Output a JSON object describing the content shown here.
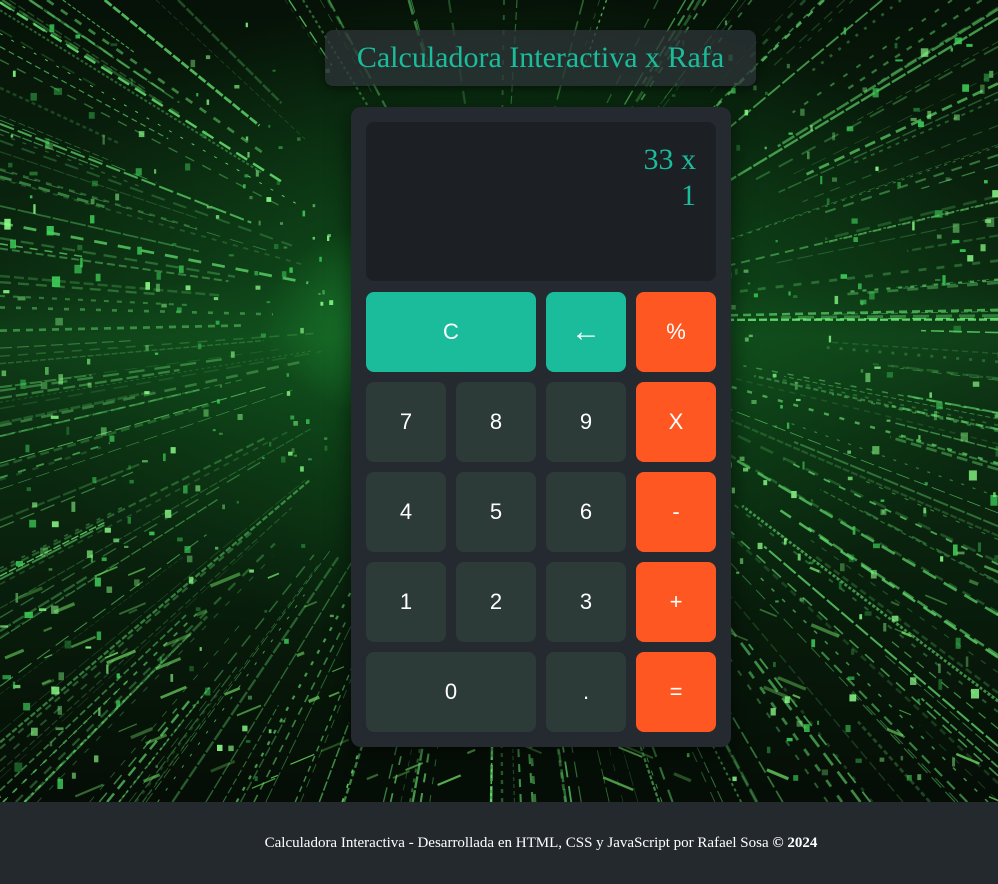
{
  "header": {
    "title": "Calculadora Interactiva x Rafa"
  },
  "display": {
    "line1": "33 x",
    "line2": "1"
  },
  "buttons": {
    "clear": "C",
    "backspace": "←",
    "percent": "%",
    "seven": "7",
    "eight": "8",
    "nine": "9",
    "multiply": "X",
    "four": "4",
    "five": "5",
    "six": "6",
    "minus": "-",
    "one": "1",
    "two": "2",
    "three": "3",
    "plus": "+",
    "zero": "0",
    "decimal": ".",
    "equals": "="
  },
  "footer": {
    "text": "Calculadora Interactiva - Desarrollada en HTML, CSS y JavaScript por Rafael Sosa ",
    "copyright": "© 2024"
  },
  "colors": {
    "accent": "#1abc9c",
    "operator": "#ff5722",
    "number_button": "#2c3a38",
    "calculator_body": "#252a30",
    "display_bg": "#1c2024",
    "footer_bg": "#24292e"
  }
}
